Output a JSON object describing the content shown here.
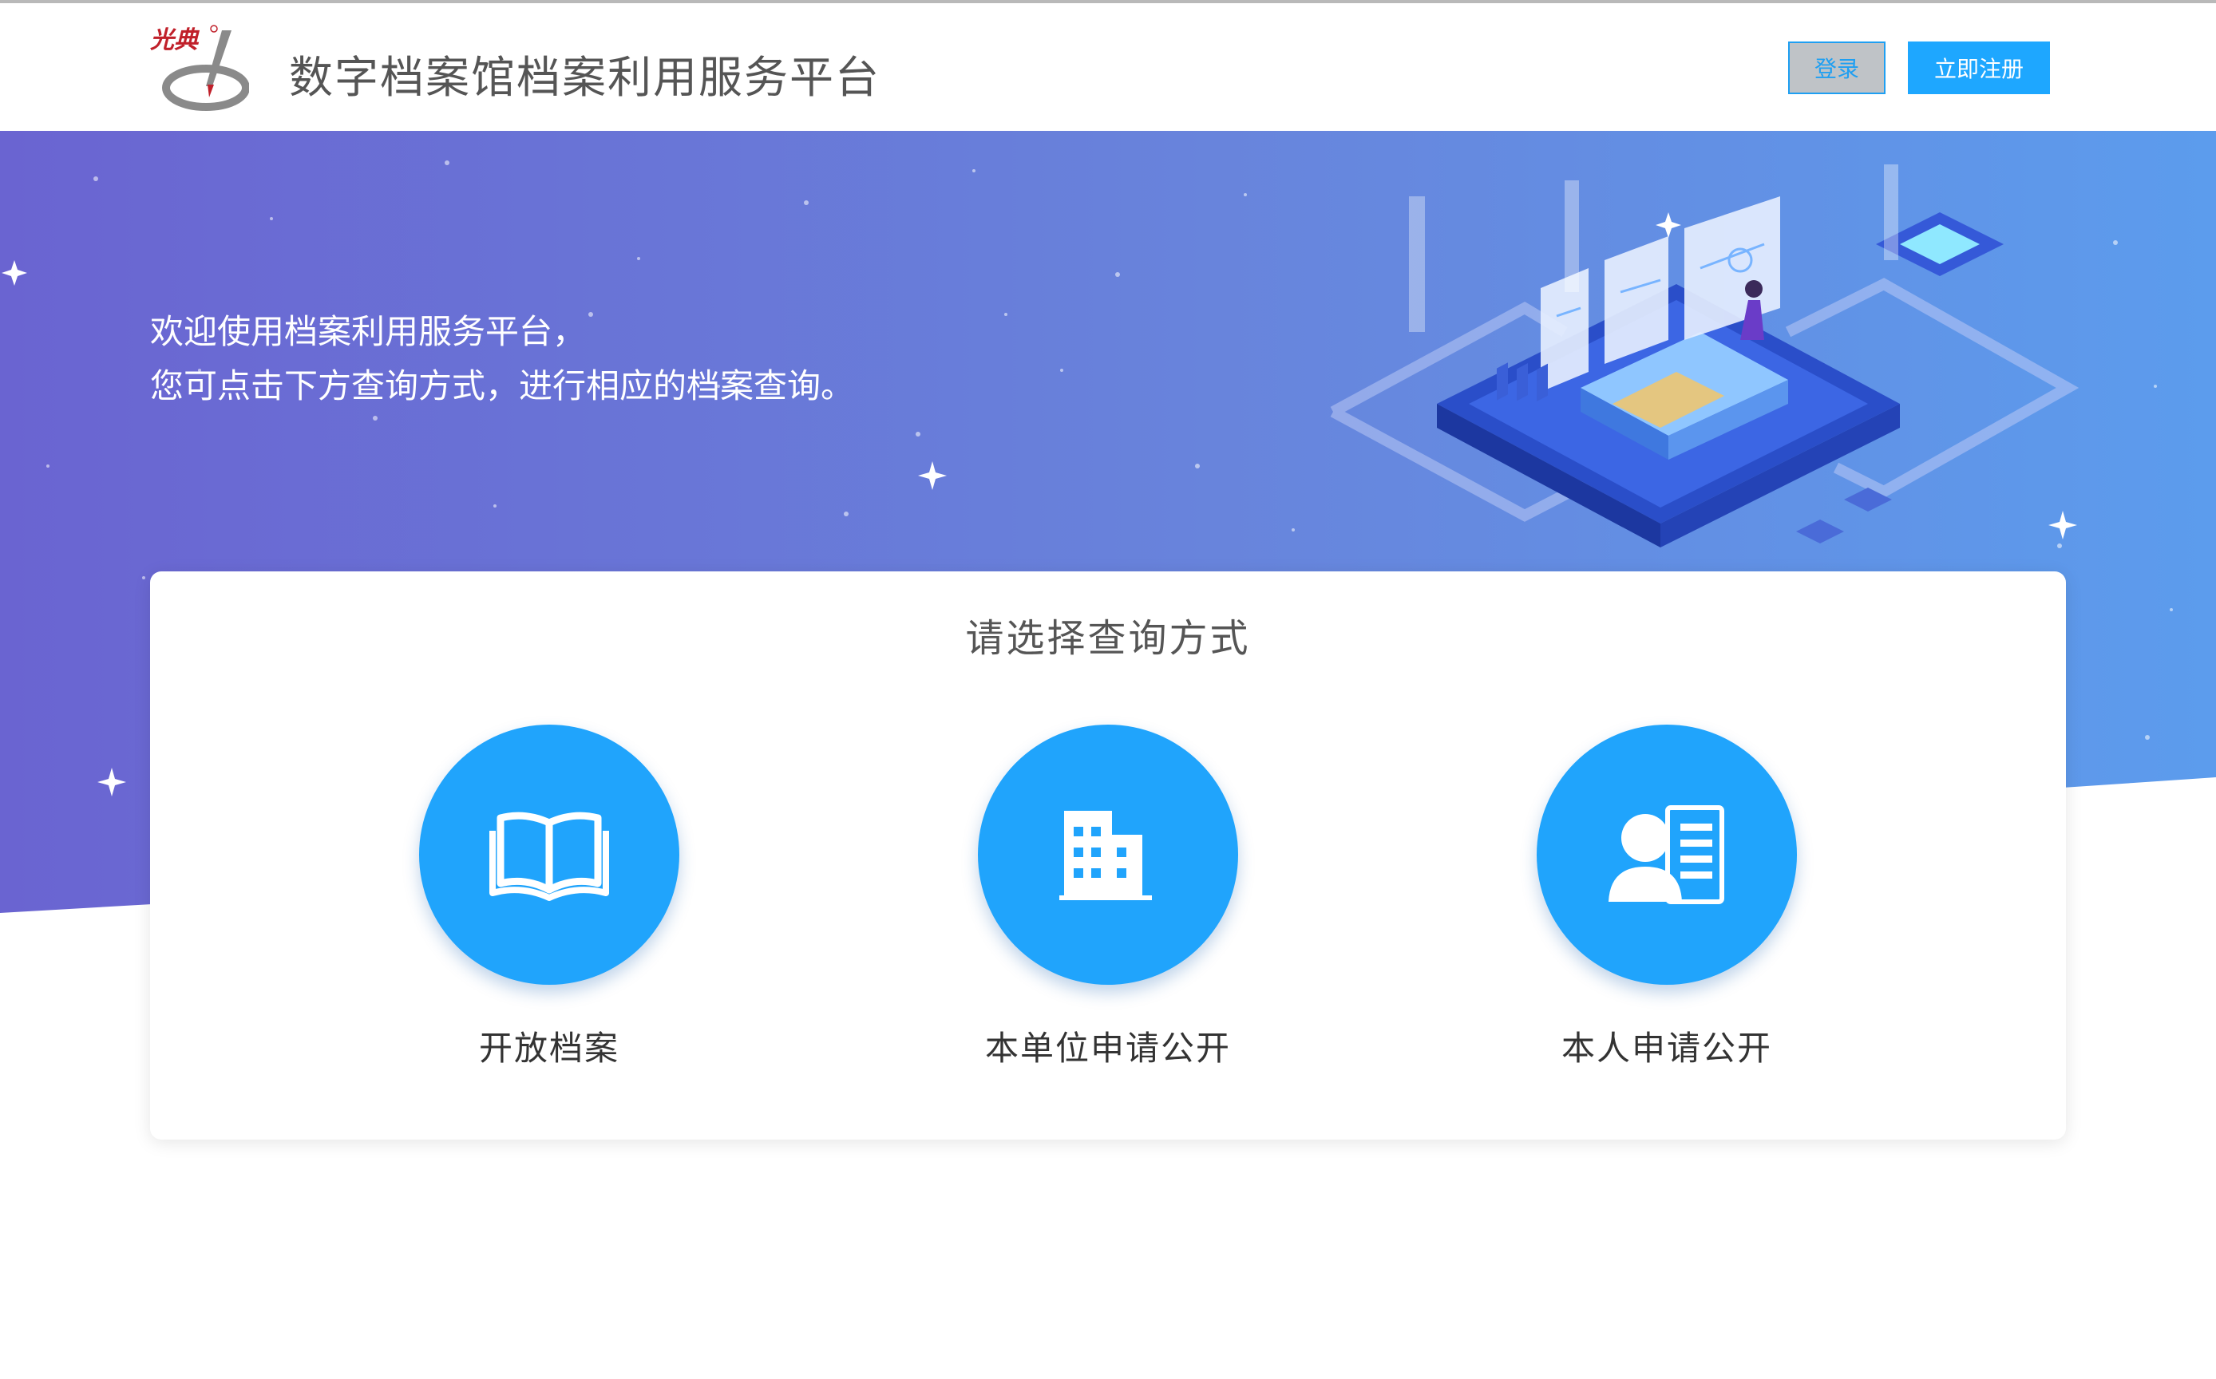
{
  "header": {
    "logo_text": "光典",
    "title": "数字档案馆档案利用服务平台",
    "login_label": "登录",
    "register_label": "立即注册"
  },
  "banner": {
    "welcome_line1": "欢迎使用档案利用服务平台，",
    "welcome_line2": "您可点击下方查询方式，进行相应的档案查询。"
  },
  "card": {
    "title": "请选择查询方式",
    "options": [
      {
        "label": "开放档案",
        "icon": "open-book-icon"
      },
      {
        "label": "本单位申请公开",
        "icon": "building-icon"
      },
      {
        "label": "本人申请公开",
        "icon": "person-document-icon"
      }
    ]
  },
  "colors": {
    "accent": "#1ea7ff",
    "banner_start": "#6a64d1",
    "banner_end": "#5a9ae8",
    "title_text": "#555555"
  }
}
